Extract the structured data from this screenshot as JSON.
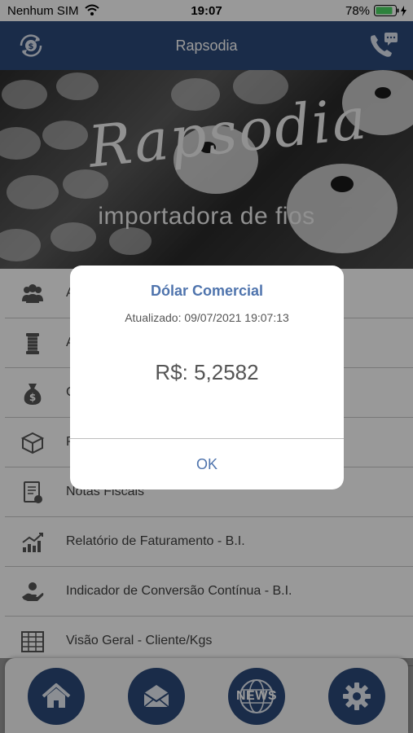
{
  "status_bar": {
    "carrier": "Nenhum SIM",
    "time": "19:07",
    "battery": "78%"
  },
  "nav": {
    "title": "Rapsodia",
    "left_icon": "currency-exchange-icon",
    "right_icon": "phone-chat-icon"
  },
  "hero": {
    "script_title": "Rapsodia",
    "subtitle": "importadora de fios"
  },
  "menu": {
    "items": [
      {
        "label": "A",
        "icon": "users-icon"
      },
      {
        "label": "A",
        "icon": "thread-spool-icon"
      },
      {
        "label": "C",
        "icon": "money-bag-icon"
      },
      {
        "label": "P",
        "icon": "package-icon"
      },
      {
        "label": "Notas Fiscais",
        "icon": "invoice-icon"
      },
      {
        "label": "Relatório de Faturamento - B.I.",
        "icon": "chart-icon"
      },
      {
        "label": "Indicador de Conversão Contínua - B.I.",
        "icon": "hand-coin-icon"
      },
      {
        "label": "Visão Geral - Cliente/Kgs",
        "icon": "table-icon"
      }
    ]
  },
  "tabbar": {
    "news_label": "NEWS",
    "items": [
      "home-icon",
      "mail-icon",
      "news-globe-icon",
      "gear-icon"
    ]
  },
  "alert": {
    "title": "Dólar Comercial",
    "updated": "Atualizado: 09/07/2021 19:07:13",
    "value": "R$: 5,2582",
    "ok_label": "OK"
  },
  "colors": {
    "primary": "#2c4a7a",
    "accent": "#4f74ad",
    "battery": "#4cd964"
  }
}
